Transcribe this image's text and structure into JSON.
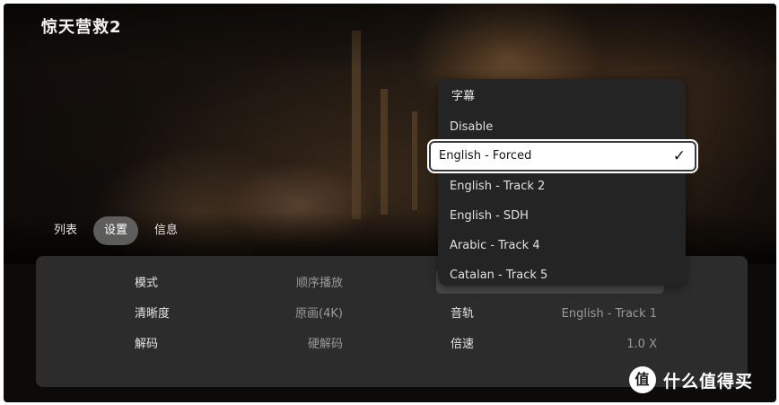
{
  "video_title": "惊天营救2",
  "tabs": [
    {
      "label": "列表",
      "active": false
    },
    {
      "label": "设置",
      "active": true
    },
    {
      "label": "信息",
      "active": false
    }
  ],
  "settings": {
    "left": [
      {
        "label": "模式",
        "value": "顺序播放"
      },
      {
        "label": "清晰度",
        "value": "原画(4K)"
      },
      {
        "label": "解码",
        "value": "硬解码"
      }
    ],
    "right": [
      {
        "label": "音轨",
        "value": "English - Track 1"
      },
      {
        "label": "倍速",
        "value": "1.0 X"
      }
    ]
  },
  "subtitle_menu": {
    "header": "字幕",
    "items": [
      {
        "label": "Disable"
      },
      {
        "label": "English - Forced",
        "selected": true
      },
      {
        "label": "English - Track 2"
      },
      {
        "label": "English - SDH"
      },
      {
        "label": "Arabic - Track 4"
      },
      {
        "label": "Catalan - Track 5"
      }
    ],
    "check_icon": "✓"
  },
  "watermark": {
    "icon": "值",
    "text": "什么值得买"
  },
  "colors": {
    "panel": "#2c2c2c",
    "menu": "#242424",
    "selected": "#ffffff"
  }
}
